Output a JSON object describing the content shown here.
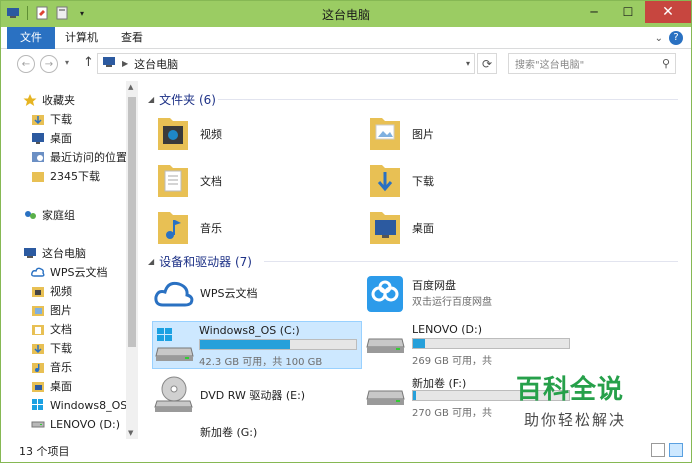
{
  "window": {
    "title": "这台电脑"
  },
  "ribbon": {
    "tabs": [
      "文件",
      "计算机",
      "查看"
    ],
    "help": "?"
  },
  "navigation": {
    "address": "这台电脑",
    "search_placeholder": "搜索\"这台电脑\""
  },
  "sidebar": {
    "items": [
      {
        "label": "收藏夹",
        "icon": "star-icon"
      },
      {
        "label": "下载",
        "icon": "download-folder-icon"
      },
      {
        "label": "桌面",
        "icon": "desktop-icon"
      },
      {
        "label": "最近访问的位置",
        "icon": "recent-places-icon"
      },
      {
        "label": "2345下载",
        "icon": "folder-icon"
      },
      {
        "label": "家庭组",
        "icon": "homegroup-icon"
      },
      {
        "label": "这台电脑",
        "icon": "computer-icon"
      },
      {
        "label": "WPS云文档",
        "icon": "cloud-icon"
      },
      {
        "label": "视频",
        "icon": "video-folder-icon"
      },
      {
        "label": "图片",
        "icon": "pictures-folder-icon"
      },
      {
        "label": "文档",
        "icon": "documents-folder-icon"
      },
      {
        "label": "下载",
        "icon": "download-folder-icon"
      },
      {
        "label": "音乐",
        "icon": "music-folder-icon"
      },
      {
        "label": "桌面",
        "icon": "desktop-folder-icon"
      },
      {
        "label": "Windows8_OS (",
        "icon": "windows-drive-icon"
      },
      {
        "label": "LENOVO (D:)",
        "icon": "drive-icon"
      }
    ]
  },
  "folders": {
    "header": "文件夹 (6)",
    "items": [
      "视频",
      "图片",
      "文档",
      "下载",
      "音乐",
      "桌面"
    ]
  },
  "devices": {
    "header": "设备和驱动器 (7)",
    "items": [
      {
        "name": "WPS云文档",
        "desc": "",
        "icon": "wps-cloud-icon"
      },
      {
        "name": "百度网盘",
        "desc": "双击运行百度网盘",
        "icon": "baidu-netdisk-icon"
      },
      {
        "name": "Windows8_OS (C:)",
        "free": "42.3 GB 可用，共 100 GB",
        "used_fraction": 0.58,
        "icon": "windows-drive-icon"
      },
      {
        "name": "LENOVO (D:)",
        "free": "269 GB 可用，共",
        "used_fraction": 0.08,
        "icon": "drive-icon"
      },
      {
        "name": "DVD RW 驱动器 (E:)",
        "icon": "dvd-drive-icon"
      },
      {
        "name": "新加卷 (F:)",
        "free": "270 GB 可用，共",
        "used_fraction": 0.02,
        "icon": "drive-icon"
      },
      {
        "name": "新加卷 (G:)",
        "icon": "drive-icon"
      }
    ]
  },
  "status": {
    "count": "13 个项目"
  },
  "watermark": {
    "title": "百科全说",
    "subtitle": "助你轻松解决"
  },
  "colors": {
    "titlebar": "#9bcc63",
    "accent": "#2a71c2",
    "bar": "#26a0da"
  }
}
